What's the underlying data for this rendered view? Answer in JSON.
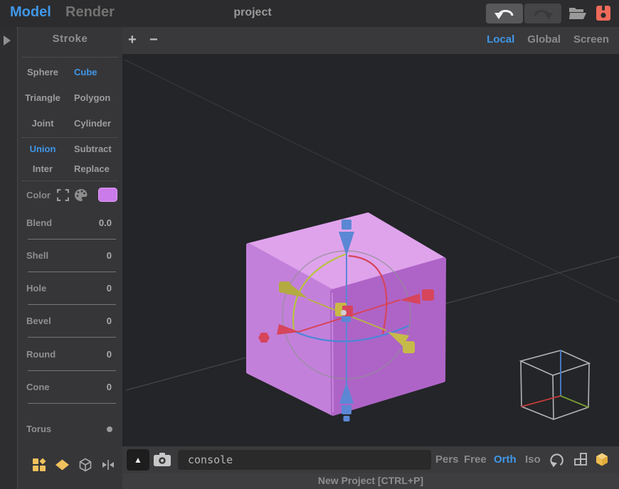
{
  "topbar": {
    "tabs": [
      {
        "label": "Model"
      },
      {
        "label": "Render"
      }
    ],
    "active_tab": "Model",
    "title": "project"
  },
  "sidebar": {
    "title": "Stroke",
    "shape_rows": [
      {
        "left": "Sphere",
        "right": "Cube"
      },
      {
        "left": "Triangle",
        "right": "Polygon"
      },
      {
        "left": "Joint",
        "right": "Cylinder"
      }
    ],
    "active_shape": "Cube",
    "bool_rows": [
      {
        "left": "Union",
        "right": "Subtract"
      },
      {
        "left": "Inter",
        "right": "Replace"
      }
    ],
    "active_bool": "Union",
    "color_label": "Color",
    "color_value": "#cb7bea",
    "params": [
      {
        "label": "Blend",
        "value": "0.0"
      },
      {
        "label": "Shell",
        "value": "0"
      },
      {
        "label": "Hole",
        "value": "0"
      },
      {
        "label": "Bevel",
        "value": "0"
      },
      {
        "label": "Round",
        "value": "0"
      },
      {
        "label": "Cone",
        "value": "0"
      }
    ],
    "torus_label": "Torus"
  },
  "viewport_toolbar": {
    "zoom_in": "+",
    "zoom_out": "−",
    "space_modes": [
      "Local",
      "Global",
      "Screen"
    ],
    "active_space": "Local"
  },
  "console_bar": {
    "expand_icon": "▲",
    "input_value": "console",
    "projection_modes": [
      "Pers",
      "Free",
      "Orth",
      "Iso"
    ],
    "active_projection": "Orth"
  },
  "status_bar": {
    "message": "New Project [CTRL+P]"
  },
  "colors": {
    "accent_blue": "#3f97e8",
    "save_red": "#ef6a5a",
    "tool_orange": "#f0c05c",
    "swatch_purple": "#cb7bea"
  },
  "scene": {
    "cube": {
      "top": "#dfa3ec",
      "left": "#c380da",
      "right": "#ae64c7"
    },
    "gizmo": {
      "x_color": "#d6455c",
      "y_color": "#b9b148",
      "z_color": "#5b87d5",
      "ring_color": "#8e9091"
    },
    "nav_cube": {
      "edge": "#b4b4b6",
      "x_axis": "#c43b3b",
      "y_axis": "#7a9a33",
      "z_axis": "#4a7fd0"
    }
  }
}
